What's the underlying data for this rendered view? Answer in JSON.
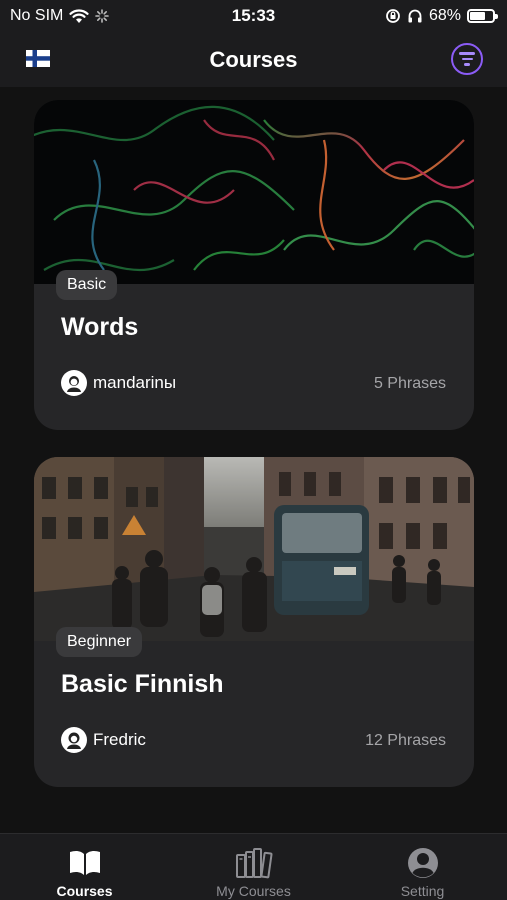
{
  "status_bar": {
    "carrier": "No SIM",
    "time": "15:33",
    "battery": "68%",
    "battery_level": 0.68
  },
  "header": {
    "title": "Courses",
    "flag_icon": "finland-flag-icon",
    "filter_icon": "filter-icon",
    "accent_color": "#8b5cf6"
  },
  "courses": [
    {
      "level": "Basic",
      "title": "Words",
      "author": "mandarinы",
      "phrases": "5 Phrases"
    },
    {
      "level": "Beginner",
      "title": "Basic Finnish",
      "author": "Fredric",
      "phrases": "12 Phrases"
    }
  ],
  "tab_bar": {
    "tabs": [
      {
        "label": "Courses",
        "icon": "open-book-icon",
        "active": true
      },
      {
        "label": "My Courses",
        "icon": "bookshelf-icon",
        "active": false
      },
      {
        "label": "Setting",
        "icon": "user-circle-icon",
        "active": false
      }
    ]
  }
}
